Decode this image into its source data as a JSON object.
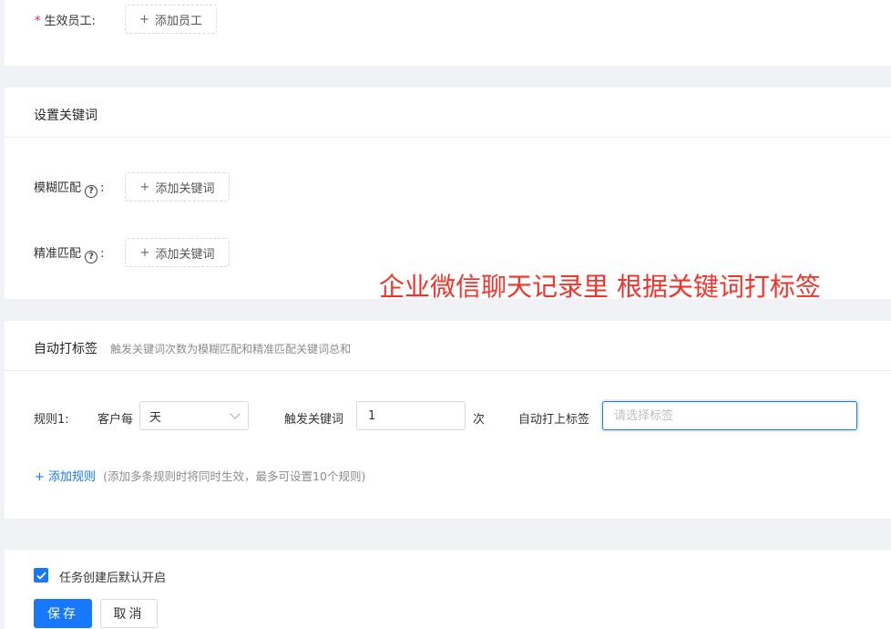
{
  "staff": {
    "required_mark": "*",
    "label": "生效员工:",
    "add_button": {
      "plus": "+",
      "text": "添加员工"
    }
  },
  "keywords": {
    "title": "设置关键词",
    "fuzzy": {
      "label": "模糊匹配",
      "help": "?",
      "colon": ":",
      "add_button": {
        "plus": "+",
        "text": "添加关键词"
      }
    },
    "exact": {
      "label": "精准匹配",
      "help": "?",
      "colon": ":",
      "add_button": {
        "plus": "+",
        "text": "添加关键词"
      }
    }
  },
  "overlay": {
    "text": "企业微信聊天记录里 根据关键词打标签",
    "color": "#f5322a"
  },
  "auto_tag": {
    "title": "自动打标签",
    "hint": "触发关键词次数为模糊匹配和精准匹配关键词总和",
    "rule": {
      "label": "规则1:",
      "per_customer_label": "客户每",
      "period_value": "天",
      "trigger_label": "触发关键词",
      "trigger_count": "1",
      "count_unit": "次",
      "tag_label": "自动打上标签",
      "tag_placeholder": "请选择标签"
    },
    "add_rule": {
      "text": "+ 添加规则",
      "hint": "(添加多条规则时将同时生效，最多可设置10个规则)"
    }
  },
  "footer": {
    "default_enable": {
      "checked": true,
      "label": "任务创建后默认开启"
    },
    "save_label": "保存",
    "cancel_label": "取消"
  },
  "colors": {
    "primary": "#1677ff",
    "required": "#f5222d",
    "background": "#f0f2f5"
  }
}
